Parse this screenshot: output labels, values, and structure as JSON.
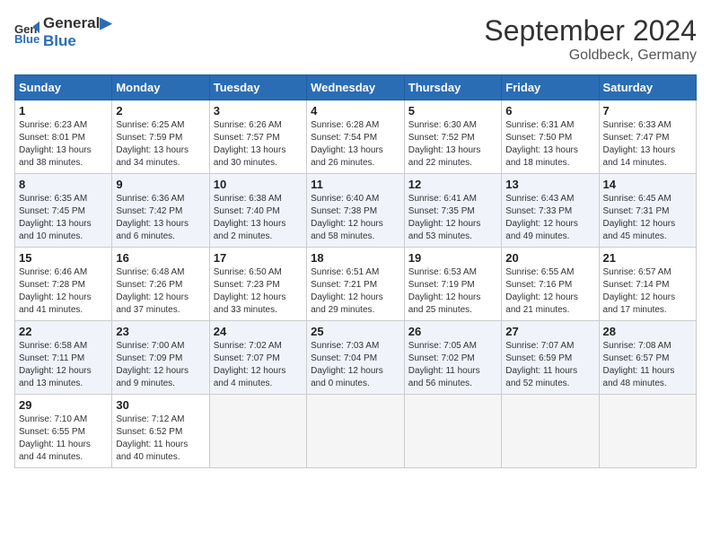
{
  "header": {
    "logo_line1": "General",
    "logo_line2": "Blue",
    "month": "September 2024",
    "location": "Goldbeck, Germany"
  },
  "days_of_week": [
    "Sunday",
    "Monday",
    "Tuesday",
    "Wednesday",
    "Thursday",
    "Friday",
    "Saturday"
  ],
  "weeks": [
    [
      {
        "num": "1",
        "info": "Sunrise: 6:23 AM\nSunset: 8:01 PM\nDaylight: 13 hours\nand 38 minutes."
      },
      {
        "num": "2",
        "info": "Sunrise: 6:25 AM\nSunset: 7:59 PM\nDaylight: 13 hours\nand 34 minutes."
      },
      {
        "num": "3",
        "info": "Sunrise: 6:26 AM\nSunset: 7:57 PM\nDaylight: 13 hours\nand 30 minutes."
      },
      {
        "num": "4",
        "info": "Sunrise: 6:28 AM\nSunset: 7:54 PM\nDaylight: 13 hours\nand 26 minutes."
      },
      {
        "num": "5",
        "info": "Sunrise: 6:30 AM\nSunset: 7:52 PM\nDaylight: 13 hours\nand 22 minutes."
      },
      {
        "num": "6",
        "info": "Sunrise: 6:31 AM\nSunset: 7:50 PM\nDaylight: 13 hours\nand 18 minutes."
      },
      {
        "num": "7",
        "info": "Sunrise: 6:33 AM\nSunset: 7:47 PM\nDaylight: 13 hours\nand 14 minutes."
      }
    ],
    [
      {
        "num": "8",
        "info": "Sunrise: 6:35 AM\nSunset: 7:45 PM\nDaylight: 13 hours\nand 10 minutes."
      },
      {
        "num": "9",
        "info": "Sunrise: 6:36 AM\nSunset: 7:42 PM\nDaylight: 13 hours\nand 6 minutes."
      },
      {
        "num": "10",
        "info": "Sunrise: 6:38 AM\nSunset: 7:40 PM\nDaylight: 13 hours\nand 2 minutes."
      },
      {
        "num": "11",
        "info": "Sunrise: 6:40 AM\nSunset: 7:38 PM\nDaylight: 12 hours\nand 58 minutes."
      },
      {
        "num": "12",
        "info": "Sunrise: 6:41 AM\nSunset: 7:35 PM\nDaylight: 12 hours\nand 53 minutes."
      },
      {
        "num": "13",
        "info": "Sunrise: 6:43 AM\nSunset: 7:33 PM\nDaylight: 12 hours\nand 49 minutes."
      },
      {
        "num": "14",
        "info": "Sunrise: 6:45 AM\nSunset: 7:31 PM\nDaylight: 12 hours\nand 45 minutes."
      }
    ],
    [
      {
        "num": "15",
        "info": "Sunrise: 6:46 AM\nSunset: 7:28 PM\nDaylight: 12 hours\nand 41 minutes."
      },
      {
        "num": "16",
        "info": "Sunrise: 6:48 AM\nSunset: 7:26 PM\nDaylight: 12 hours\nand 37 minutes."
      },
      {
        "num": "17",
        "info": "Sunrise: 6:50 AM\nSunset: 7:23 PM\nDaylight: 12 hours\nand 33 minutes."
      },
      {
        "num": "18",
        "info": "Sunrise: 6:51 AM\nSunset: 7:21 PM\nDaylight: 12 hours\nand 29 minutes."
      },
      {
        "num": "19",
        "info": "Sunrise: 6:53 AM\nSunset: 7:19 PM\nDaylight: 12 hours\nand 25 minutes."
      },
      {
        "num": "20",
        "info": "Sunrise: 6:55 AM\nSunset: 7:16 PM\nDaylight: 12 hours\nand 21 minutes."
      },
      {
        "num": "21",
        "info": "Sunrise: 6:57 AM\nSunset: 7:14 PM\nDaylight: 12 hours\nand 17 minutes."
      }
    ],
    [
      {
        "num": "22",
        "info": "Sunrise: 6:58 AM\nSunset: 7:11 PM\nDaylight: 12 hours\nand 13 minutes."
      },
      {
        "num": "23",
        "info": "Sunrise: 7:00 AM\nSunset: 7:09 PM\nDaylight: 12 hours\nand 9 minutes."
      },
      {
        "num": "24",
        "info": "Sunrise: 7:02 AM\nSunset: 7:07 PM\nDaylight: 12 hours\nand 4 minutes."
      },
      {
        "num": "25",
        "info": "Sunrise: 7:03 AM\nSunset: 7:04 PM\nDaylight: 12 hours\nand 0 minutes."
      },
      {
        "num": "26",
        "info": "Sunrise: 7:05 AM\nSunset: 7:02 PM\nDaylight: 11 hours\nand 56 minutes."
      },
      {
        "num": "27",
        "info": "Sunrise: 7:07 AM\nSunset: 6:59 PM\nDaylight: 11 hours\nand 52 minutes."
      },
      {
        "num": "28",
        "info": "Sunrise: 7:08 AM\nSunset: 6:57 PM\nDaylight: 11 hours\nand 48 minutes."
      }
    ],
    [
      {
        "num": "29",
        "info": "Sunrise: 7:10 AM\nSunset: 6:55 PM\nDaylight: 11 hours\nand 44 minutes."
      },
      {
        "num": "30",
        "info": "Sunrise: 7:12 AM\nSunset: 6:52 PM\nDaylight: 11 hours\nand 40 minutes."
      },
      {
        "num": "",
        "info": ""
      },
      {
        "num": "",
        "info": ""
      },
      {
        "num": "",
        "info": ""
      },
      {
        "num": "",
        "info": ""
      },
      {
        "num": "",
        "info": ""
      }
    ]
  ]
}
